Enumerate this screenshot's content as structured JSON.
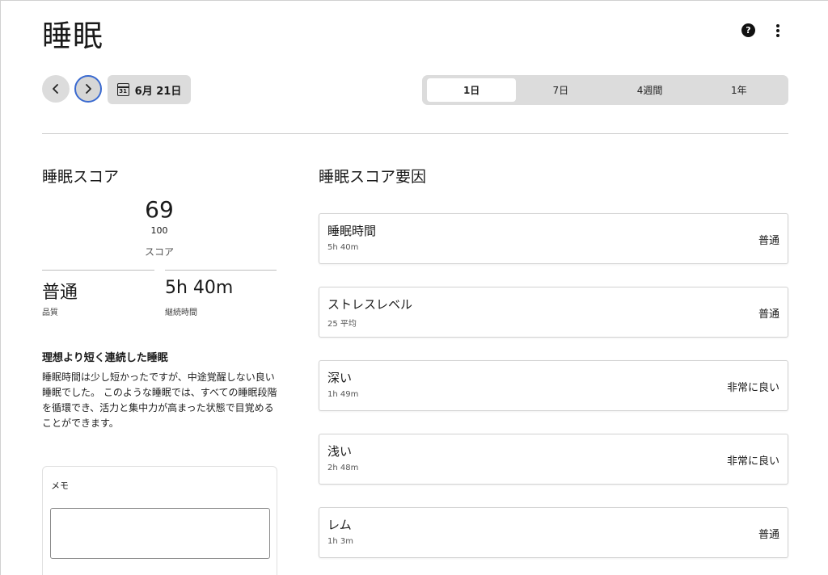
{
  "page": {
    "title": "睡眠"
  },
  "header": {
    "help_icon": "help-circle-icon",
    "more_icon": "more-vertical-icon",
    "help_glyph": "?"
  },
  "date_nav": {
    "prev_icon": "chevron-left-icon",
    "next_icon": "chevron-right-icon",
    "calendar_icon": "calendar-icon",
    "calendar_day": "31",
    "date_label": "6月 21日"
  },
  "range_tabs": [
    {
      "label": "1日",
      "active": true
    },
    {
      "label": "7日",
      "active": false
    },
    {
      "label": "4週間",
      "active": false
    },
    {
      "label": "1年",
      "active": false
    }
  ],
  "sleep_score": {
    "section_title": "睡眠スコア",
    "value": "69",
    "max": "100",
    "label": "スコア",
    "quality_value": "普通",
    "quality_caption": "品質",
    "duration_value": "5h 40m",
    "duration_caption": "継続時間",
    "insight_title": "理想より短く連続した睡眠",
    "insight_body": "睡眠時間は少し短かったですが、中途覚醒しない良い睡眠でした。 このような睡眠では、すべての睡眠段階を循環でき、活力と集中力が高まった状態で目覚めることができます。"
  },
  "memo": {
    "label": "メモ",
    "value": "",
    "placeholder": ""
  },
  "factors": {
    "section_title": "睡眠スコア要因",
    "items": [
      {
        "name": "睡眠時間",
        "sub": "5h 40m",
        "rating": "普通"
      },
      {
        "name": "ストレスレベル",
        "sub": "25 平均",
        "rating": "普通"
      },
      {
        "name": "深い",
        "sub": "1h 49m",
        "rating": "非常に良い"
      },
      {
        "name": "浅い",
        "sub": "2h 48m",
        "rating": "非常に良い"
      },
      {
        "name": "レム",
        "sub": "1h 3m",
        "rating": "普通"
      }
    ]
  },
  "colors": {
    "accent": "#3a6ad0",
    "control_bg": "#dcdcdc",
    "divider": "#cfcfcf"
  }
}
